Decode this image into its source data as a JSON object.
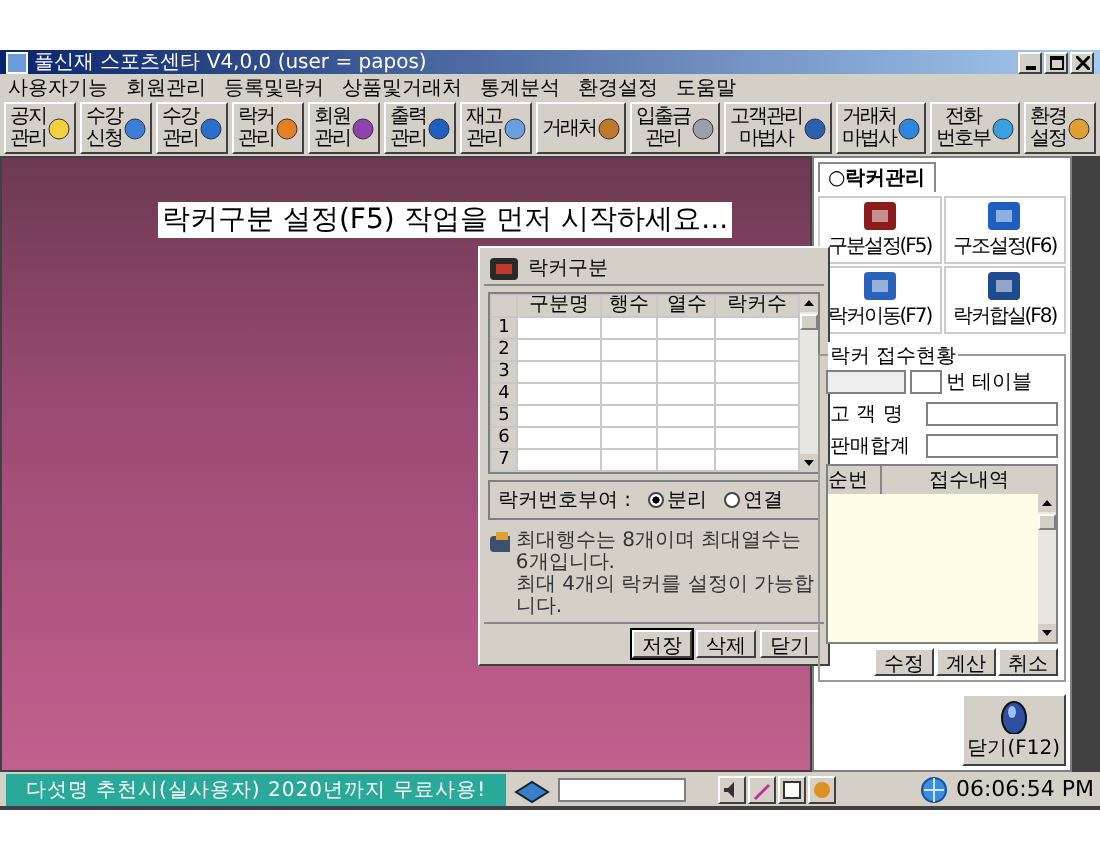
{
  "window": {
    "title": "풀신재 스포츠센타 V4,0,0 (user = papos)"
  },
  "menu": [
    "사용자기능",
    "회원관리",
    "등록및락커",
    "상품및거래처",
    "통계분석",
    "환경설정",
    "도움말"
  ],
  "toolbar": [
    {
      "lines": [
        "공지",
        "관리"
      ]
    },
    {
      "lines": [
        "수강",
        "신청"
      ]
    },
    {
      "lines": [
        "수강",
        "관리"
      ]
    },
    {
      "lines": [
        "락커",
        "관리"
      ]
    },
    {
      "lines": [
        "회원",
        "관리"
      ]
    },
    {
      "lines": [
        "출력",
        "관리"
      ]
    },
    {
      "lines": [
        "재고",
        "관리"
      ]
    },
    {
      "lines": [
        "거래처"
      ]
    },
    {
      "lines": [
        "입출금",
        "관리"
      ]
    },
    {
      "lines": [
        "고객관리",
        "마법사"
      ]
    },
    {
      "lines": [
        "거래처",
        "마법사"
      ]
    },
    {
      "lines": [
        "전화",
        "번호부"
      ]
    },
    {
      "lines": [
        "환경",
        "설정"
      ]
    }
  ],
  "message": "락커구분 설정(F5) 작업을 먼저 시작하세요...",
  "dialog": {
    "title": "락커구분",
    "columns": [
      "구분명",
      "행수",
      "열수",
      "락커수"
    ],
    "rows": [
      "1",
      "2",
      "3",
      "4",
      "5",
      "6",
      "7"
    ],
    "numbering": {
      "label": "락커번호부여 :",
      "options": [
        {
          "label": "분리",
          "selected": true
        },
        {
          "label": "연결",
          "selected": false
        }
      ]
    },
    "note": [
      "최대행수는 8개이며 최대열수는 6개입니다.",
      "최대 4개의 락커를 설정이 가능합니다."
    ],
    "buttons": [
      "저장",
      "삭제",
      "닫기"
    ]
  },
  "side_panel": {
    "tab": "○락커관리",
    "buttons": [
      "구분설정(F5)",
      "구조설정(F6)",
      "락커이동(F7)",
      "락커합실(F8)"
    ],
    "group": {
      "title": "락커 접수현황",
      "table_suffix": "번 테이블",
      "fields": [
        "고 객 명",
        "판매합계"
      ],
      "columns": [
        "순번",
        "접수내역"
      ],
      "buttons": [
        "수정",
        "계산",
        "취소"
      ]
    },
    "close_button": "닫기(F12)"
  },
  "status_bar": {
    "notice": "다섯명 추천시(실사용자) 2020년까지 무료사용!",
    "time": "06:06:54 PM"
  }
}
